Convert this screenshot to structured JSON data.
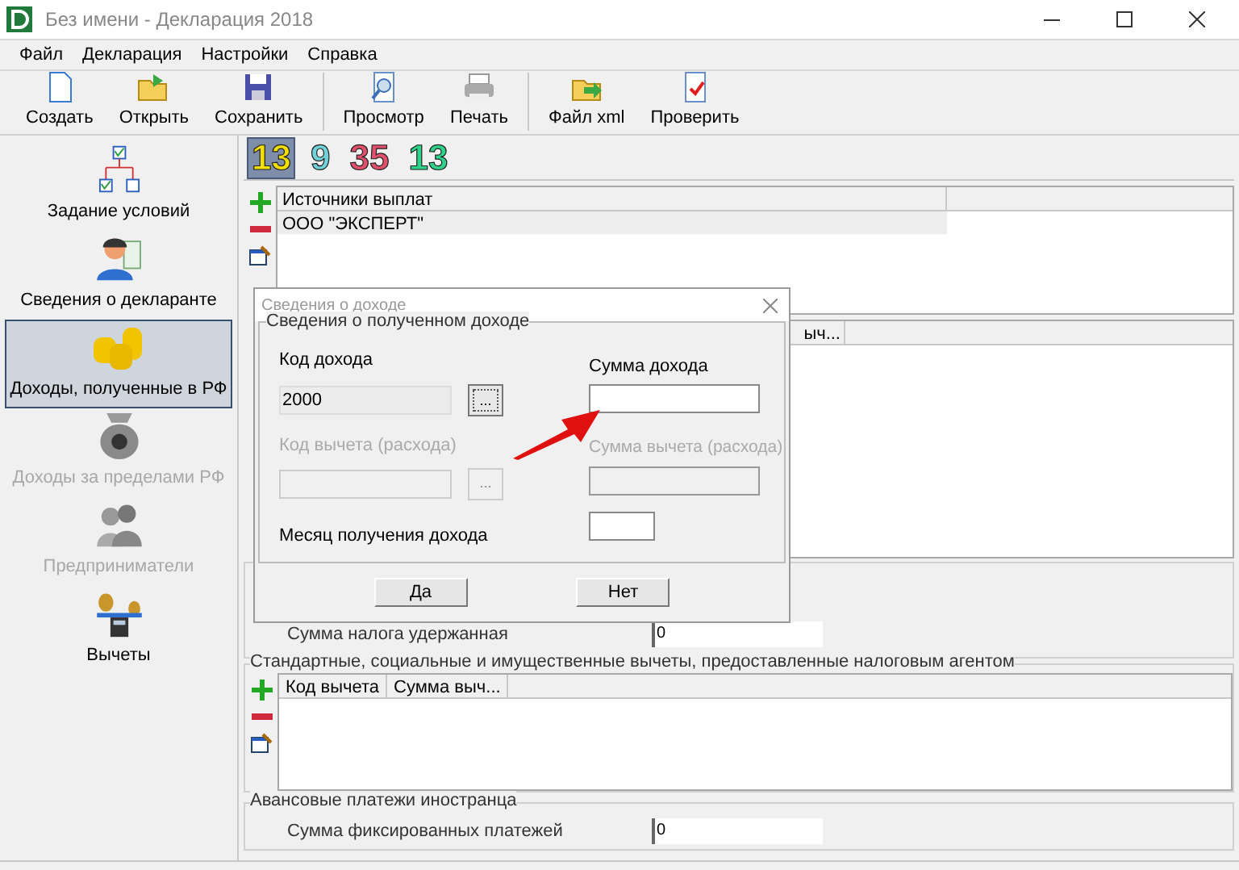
{
  "window": {
    "title": "Без имени - Декларация 2018"
  },
  "menu": [
    "Файл",
    "Декларация",
    "Настройки",
    "Справка"
  ],
  "toolbar": [
    {
      "buttons": [
        "Создать",
        "Открыть",
        "Сохранить"
      ]
    },
    {
      "buttons": [
        "Просмотр",
        "Печать"
      ]
    },
    {
      "buttons": [
        "Файл xml",
        "Проверить"
      ]
    }
  ],
  "sidebar": {
    "items": [
      {
        "label": "Задание условий",
        "selected": false,
        "disabled": false
      },
      {
        "label": "Сведения о декларанте",
        "selected": false,
        "disabled": false
      },
      {
        "label": "Доходы, полученные в РФ",
        "selected": true,
        "disabled": false
      },
      {
        "label": "Доходы за пределами РФ",
        "selected": false,
        "disabled": true
      },
      {
        "label": "Предприниматели",
        "selected": false,
        "disabled": true
      },
      {
        "label": "Вычеты",
        "selected": false,
        "disabled": false
      }
    ]
  },
  "rate_tabs": [
    {
      "label": "13",
      "color": "#f2de00",
      "selected": true
    },
    {
      "label": "9",
      "color": "#6fd3d8",
      "selected": false
    },
    {
      "label": "35",
      "color": "#e0506a",
      "selected": false
    },
    {
      "label": "13",
      "color": "#2ed38a",
      "selected": false
    }
  ],
  "sources": {
    "columns": [
      "Источники выплат"
    ],
    "rows": [
      "ООО \"ЭКСПЕРТ\""
    ]
  },
  "income": {
    "column_partial": "ыч..."
  },
  "tax_withheld": {
    "label": "Сумма налога удержанная",
    "value": "0"
  },
  "deductions": {
    "title": "Стандартные, социальные и имущественные вычеты, предоставленные налоговым агентом",
    "columns": [
      "Код вычета",
      "Сумма выч..."
    ]
  },
  "advance": {
    "title": "Авансовые платежи иностранца",
    "label": "Сумма фиксированных платежей",
    "value": "0"
  },
  "dialog": {
    "title": "Сведения о доходе",
    "group": "Сведения о полученном доходе",
    "income_code": {
      "label": "Код дохода",
      "value": "2000",
      "browse": "..."
    },
    "deduction_code": {
      "label": "Код вычета (расхода)",
      "disabled": true,
      "browse": "..."
    },
    "income_sum": {
      "label": "Сумма дохода",
      "disabled": false
    },
    "deduction_sum": {
      "label": "Сумма вычета (расхода)",
      "disabled": true
    },
    "month": {
      "label": "Месяц получения дохода"
    },
    "buttons": [
      "Да",
      "Нет"
    ]
  }
}
